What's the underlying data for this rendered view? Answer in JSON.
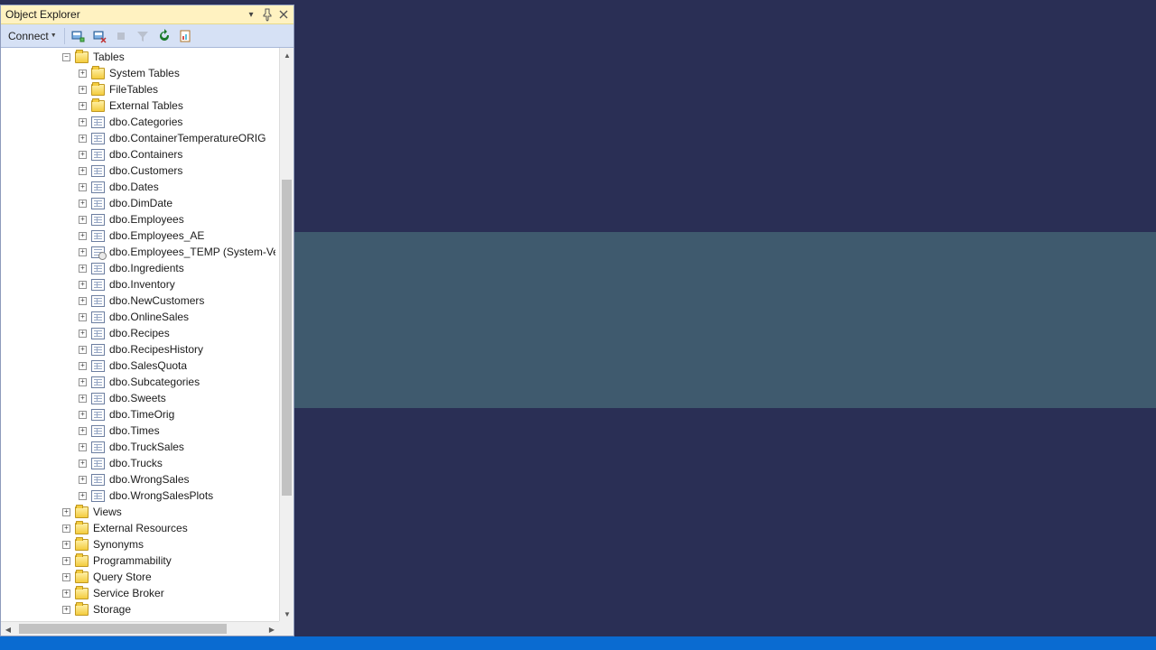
{
  "panel": {
    "title": "Object Explorer"
  },
  "toolbar": {
    "connect_label": "Connect"
  },
  "status": {
    "text": ""
  },
  "tree": {
    "root": {
      "label": "Tables",
      "expanded": true
    },
    "table_children": [
      {
        "label": "System Tables",
        "icon": "folder"
      },
      {
        "label": "FileTables",
        "icon": "folder"
      },
      {
        "label": "External Tables",
        "icon": "folder"
      },
      {
        "label": "dbo.Categories",
        "icon": "table"
      },
      {
        "label": "dbo.ContainerTemperatureORIG",
        "icon": "table"
      },
      {
        "label": "dbo.Containers",
        "icon": "table"
      },
      {
        "label": "dbo.Customers",
        "icon": "table"
      },
      {
        "label": "dbo.Dates",
        "icon": "table"
      },
      {
        "label": "dbo.DimDate",
        "icon": "table"
      },
      {
        "label": "dbo.Employees",
        "icon": "table"
      },
      {
        "label": "dbo.Employees_AE",
        "icon": "table"
      },
      {
        "label": "dbo.Employees_TEMP (System-Ver",
        "icon": "table-sys"
      },
      {
        "label": "dbo.Ingredients",
        "icon": "table"
      },
      {
        "label": "dbo.Inventory",
        "icon": "table"
      },
      {
        "label": "dbo.NewCustomers",
        "icon": "table"
      },
      {
        "label": "dbo.OnlineSales",
        "icon": "table"
      },
      {
        "label": "dbo.Recipes",
        "icon": "table"
      },
      {
        "label": "dbo.RecipesHistory",
        "icon": "table"
      },
      {
        "label": "dbo.SalesQuota",
        "icon": "table"
      },
      {
        "label": "dbo.Subcategories",
        "icon": "table"
      },
      {
        "label": "dbo.Sweets",
        "icon": "table"
      },
      {
        "label": "dbo.TimeOrig",
        "icon": "table"
      },
      {
        "label": "dbo.Times",
        "icon": "table"
      },
      {
        "label": "dbo.TruckSales",
        "icon": "table"
      },
      {
        "label": "dbo.Trucks",
        "icon": "table"
      },
      {
        "label": "dbo.WrongSales",
        "icon": "table"
      },
      {
        "label": "dbo.WrongSalesPlots",
        "icon": "table"
      }
    ],
    "siblings": [
      {
        "label": "Views"
      },
      {
        "label": "External Resources"
      },
      {
        "label": "Synonyms"
      },
      {
        "label": "Programmability"
      },
      {
        "label": "Query Store"
      },
      {
        "label": "Service Broker"
      },
      {
        "label": "Storage"
      }
    ]
  }
}
